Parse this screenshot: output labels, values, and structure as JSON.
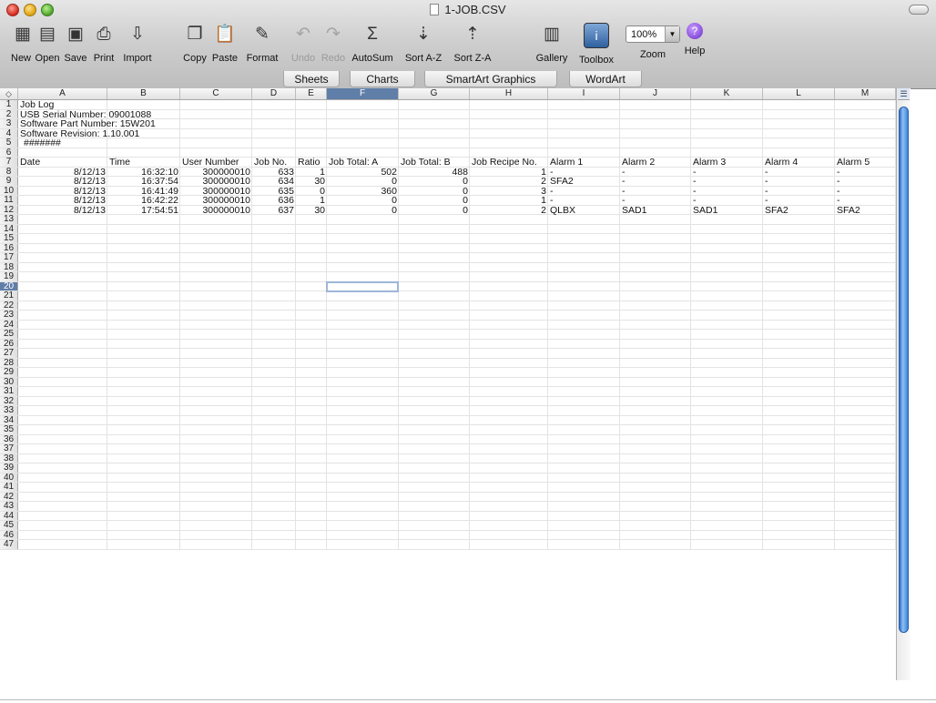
{
  "window": {
    "title": "1-JOB.CSV"
  },
  "toolbar": {
    "items": [
      {
        "label": "New",
        "icon": "new-workbook-icon",
        "glyph": "▦"
      },
      {
        "label": "Open",
        "icon": "open-icon",
        "glyph": "▤"
      },
      {
        "label": "Save",
        "icon": "save-icon",
        "glyph": "▣"
      },
      {
        "label": "Print",
        "icon": "print-icon",
        "glyph": "⎙"
      },
      {
        "label": "Import",
        "icon": "import-icon",
        "glyph": "⇩"
      },
      {
        "label": "Copy",
        "icon": "copy-icon",
        "glyph": "❐"
      },
      {
        "label": "Paste",
        "icon": "paste-icon",
        "glyph": "📋"
      },
      {
        "label": "Format",
        "icon": "format-painter-icon",
        "glyph": "✎"
      },
      {
        "label": "Undo",
        "icon": "undo-icon",
        "glyph": "↶"
      },
      {
        "label": "Redo",
        "icon": "redo-icon",
        "glyph": "↷"
      },
      {
        "label": "AutoSum",
        "icon": "autosum-icon",
        "glyph": "Σ"
      },
      {
        "label": "Sort A-Z",
        "icon": "sort-ascending-icon",
        "glyph": "⇣"
      },
      {
        "label": "Sort Z-A",
        "icon": "sort-descending-icon",
        "glyph": "⇡"
      },
      {
        "label": "Gallery",
        "icon": "gallery-icon",
        "glyph": "▥"
      },
      {
        "label": "Toolbox",
        "icon": "toolbox-icon",
        "glyph": "i"
      },
      {
        "label": "Zoom",
        "icon": "zoom-icon",
        "value": "100%"
      },
      {
        "label": "Help",
        "icon": "help-icon",
        "glyph": "?"
      }
    ]
  },
  "ribbon_tabs": [
    "Sheets",
    "Charts",
    "SmartArt Graphics",
    "WordArt"
  ],
  "grid": {
    "corner": "◇",
    "columns": [
      "A",
      "B",
      "C",
      "D",
      "E",
      "F",
      "G",
      "H",
      "I",
      "J",
      "K",
      "L",
      "M"
    ],
    "selected_column": "F",
    "selected_row": "20",
    "row_numbers": [
      "1",
      "2",
      "3",
      "4",
      "5",
      "6",
      "7",
      "8",
      "9",
      "10",
      "11",
      "12",
      "13",
      "14",
      "15",
      "16",
      "17",
      "18",
      "19",
      "20",
      "21",
      "22",
      "23",
      "24",
      "25",
      "26",
      "27",
      "28",
      "29",
      "30",
      "31",
      "32",
      "33",
      "34",
      "35",
      "36",
      "37",
      "38",
      "39",
      "40",
      "41",
      "42",
      "43",
      "44",
      "45",
      "46",
      "47"
    ],
    "rows": [
      [
        "Job Log",
        "",
        "",
        "",
        "",
        "",
        "",
        "",
        "",
        "",
        "",
        "",
        ""
      ],
      [
        "USB Serial Number: 09001088",
        "",
        "",
        "",
        "",
        "",
        "",
        "",
        "",
        "",
        "",
        "",
        ""
      ],
      [
        "Software Part Number: 15W201",
        "",
        "",
        "",
        "",
        "",
        "",
        "",
        "",
        "",
        "",
        "",
        ""
      ],
      [
        "Software Revision: 1.10.001",
        "",
        "",
        "",
        "",
        "",
        "",
        "",
        "",
        "",
        "",
        "",
        ""
      ],
      [
        "#######",
        "",
        "",
        "",
        "",
        "",
        "",
        "",
        "",
        "",
        "",
        "",
        ""
      ],
      [
        "",
        "",
        "",
        "",
        "",
        "",
        "",
        "",
        "",
        "",
        "",
        "",
        ""
      ],
      [
        "Date",
        "Time",
        "User Number",
        "Job No.",
        "Ratio",
        "Job Total: A",
        "Job Total: B",
        "Job Recipe No.",
        "Alarm 1",
        "Alarm 2",
        "Alarm 3",
        "Alarm 4",
        "Alarm 5"
      ],
      [
        "8/12/13",
        "16:32:10",
        "300000010",
        "633",
        "1",
        "502",
        "488",
        "1",
        "-",
        "-",
        "-",
        "-",
        "-"
      ],
      [
        "8/12/13",
        "16:37:54",
        "300000010",
        "634",
        "30",
        "0",
        "0",
        "2",
        "SFA2",
        "-",
        "-",
        "-",
        "-"
      ],
      [
        "8/12/13",
        "16:41:49",
        "300000010",
        "635",
        "0",
        "360",
        "0",
        "3",
        "-",
        "-",
        "-",
        "-",
        "-"
      ],
      [
        "8/12/13",
        "16:42:22",
        "300000010",
        "636",
        "1",
        "0",
        "0",
        "1",
        "-",
        "-",
        "-",
        "-",
        "-"
      ],
      [
        "8/12/13",
        "17:54:51",
        "300000010",
        "637",
        "30",
        "0",
        "0",
        "2",
        "QLBX",
        "SAD1",
        "SAD1",
        "SFA2",
        "SFA2"
      ]
    ]
  }
}
